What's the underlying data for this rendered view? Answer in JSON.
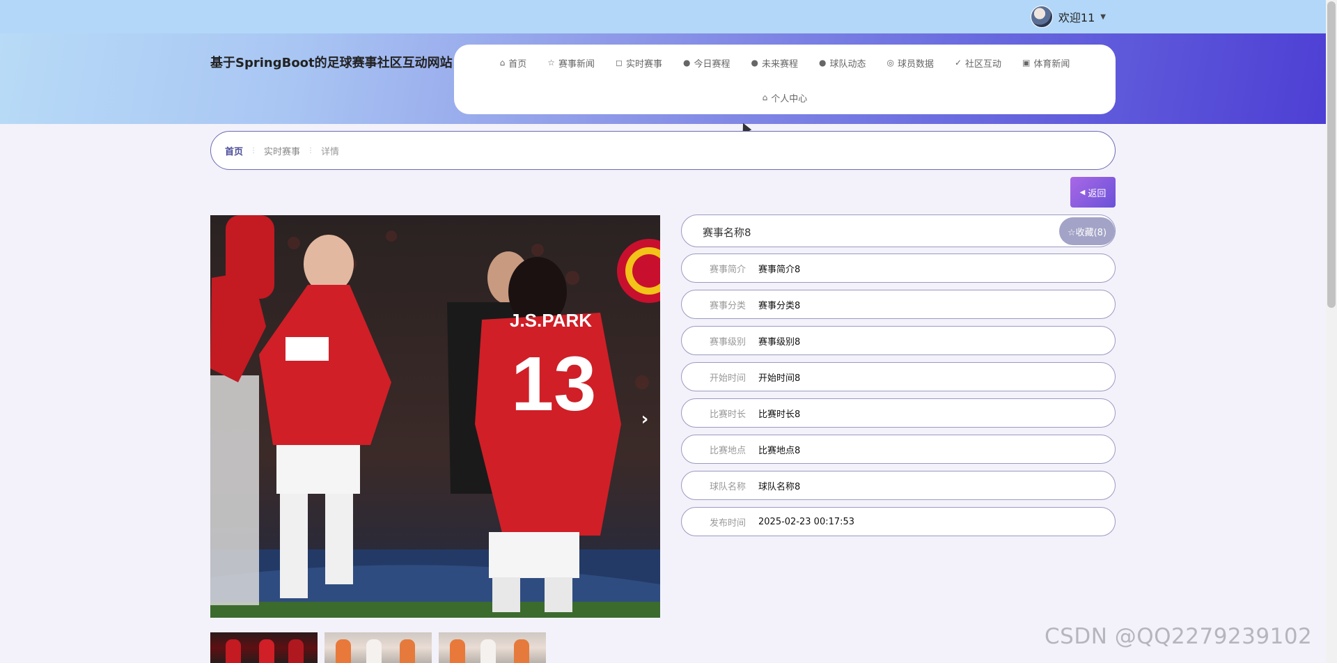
{
  "user": {
    "welcome": "欢迎11",
    "caret": "▼"
  },
  "header": {
    "title": "基于SpringBoot的足球赛事社区互动网站"
  },
  "nav": {
    "row1": [
      {
        "icon": "⌂",
        "label": "首页",
        "name": "nav-home"
      },
      {
        "icon": "☆",
        "label": "赛事新闻",
        "name": "nav-match-news"
      },
      {
        "icon": "◻",
        "label": "实时赛事",
        "name": "nav-live-matches"
      },
      {
        "icon": "●",
        "label": "今日赛程",
        "name": "nav-today-schedule"
      },
      {
        "icon": "●",
        "label": "未来赛程",
        "name": "nav-future-schedule"
      },
      {
        "icon": "●",
        "label": "球队动态",
        "name": "nav-team-news"
      },
      {
        "icon": "◎",
        "label": "球员数据",
        "name": "nav-player-data"
      },
      {
        "icon": "✓",
        "label": "社区互动",
        "name": "nav-community"
      },
      {
        "icon": "▣",
        "label": "体育新闻",
        "name": "nav-sports-news"
      }
    ],
    "row2": [
      {
        "icon": "⌂",
        "label": "个人中心",
        "name": "nav-personal-center"
      }
    ]
  },
  "breadcrumb": {
    "home": "首页",
    "section": "实时赛事",
    "current": "详情",
    "separator": "⋮"
  },
  "back_button": {
    "icon": "◀",
    "label": "返回"
  },
  "gallery": {
    "next_icon": "›"
  },
  "match": {
    "title": "赛事名称8",
    "favorite": "☆收藏(8)",
    "fields": [
      {
        "label": "赛事简介",
        "value": "赛事简介8"
      },
      {
        "label": "赛事分类",
        "value": "赛事分类8"
      },
      {
        "label": "赛事级别",
        "value": "赛事级别8"
      },
      {
        "label": "开始时间",
        "value": "开始时间8"
      },
      {
        "label": "比赛时长",
        "value": "比赛时长8"
      },
      {
        "label": "比赛地点",
        "value": "比赛地点8"
      },
      {
        "label": "球队名称",
        "value": "球队名称8"
      },
      {
        "label": "发布时间",
        "value": "2025-02-23 00:17:53"
      }
    ]
  },
  "watermark": "CSDN @QQ2279239102"
}
